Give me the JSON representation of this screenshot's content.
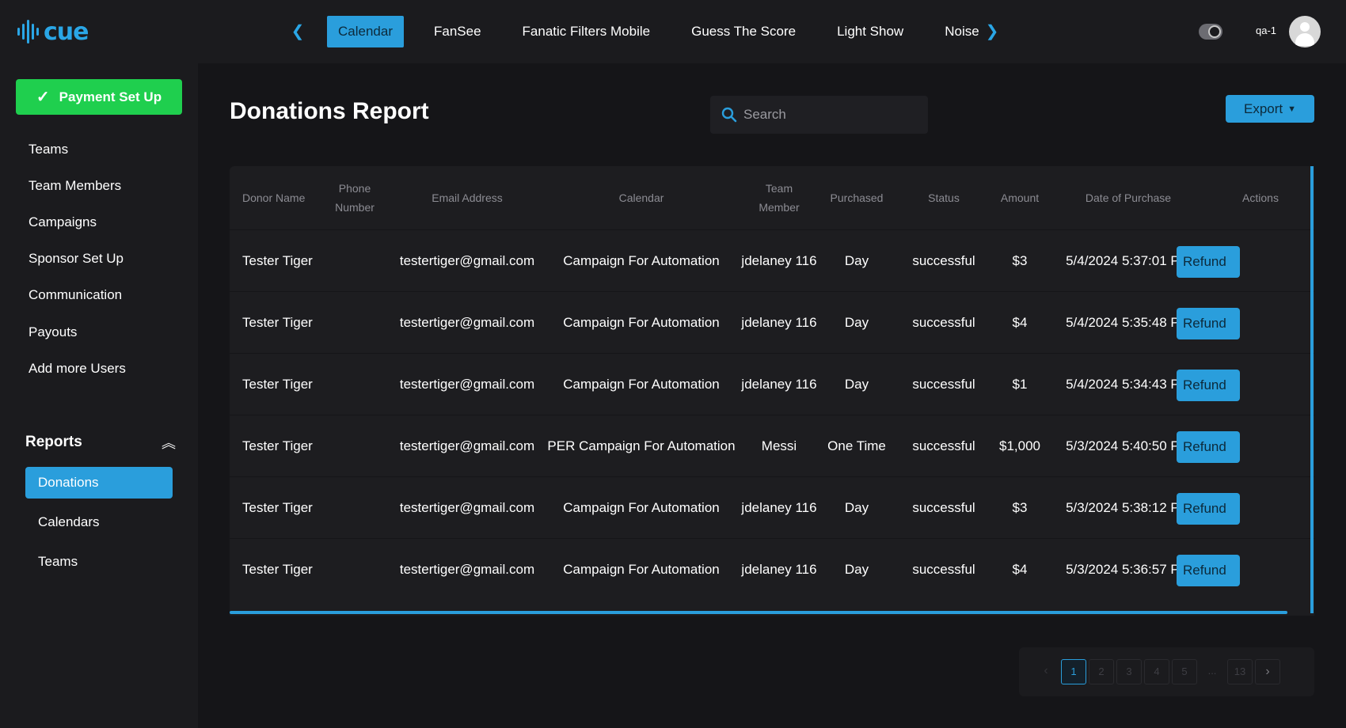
{
  "brand": {
    "name": "cue"
  },
  "tabs": [
    "Calendar",
    "FanSee",
    "Fanatic Filters Mobile",
    "Guess The Score",
    "Light Show",
    "Noise"
  ],
  "user": {
    "name": "qa-1"
  },
  "sidebar": {
    "payment_button": "Payment Set Up",
    "items": [
      "Teams",
      "Team Members",
      "Campaigns",
      "Sponsor Set Up",
      "Communication",
      "Payouts",
      "Add more Users"
    ],
    "reports": {
      "label": "Reports",
      "items": [
        "Donations",
        "Calendars",
        "Teams"
      ]
    }
  },
  "page": {
    "title": "Donations Report",
    "search_placeholder": "Search",
    "export_label": "Export"
  },
  "table": {
    "headers": [
      "Donor Name",
      "Phone Number",
      "Email Address",
      "Calendar",
      "Team Member",
      "Purchased",
      "Status",
      "Amount",
      "Date of Purchase",
      "Actions"
    ],
    "action_label": "Refund",
    "rows": [
      {
        "donor": "Tester Tiger",
        "phone": "",
        "email": "testertiger@gmail.com",
        "calendar": "Campaign For Automation",
        "member": "jdelaney 116",
        "purchased": "Day",
        "status": "successful",
        "amount": "$3",
        "date": "5/4/2024 5:37:01 PM"
      },
      {
        "donor": "Tester Tiger",
        "phone": "",
        "email": "testertiger@gmail.com",
        "calendar": "Campaign For Automation",
        "member": "jdelaney 116",
        "purchased": "Day",
        "status": "successful",
        "amount": "$4",
        "date": "5/4/2024 5:35:48 PM"
      },
      {
        "donor": "Tester Tiger",
        "phone": "",
        "email": "testertiger@gmail.com",
        "calendar": "Campaign For Automation",
        "member": "jdelaney 116",
        "purchased": "Day",
        "status": "successful",
        "amount": "$1",
        "date": "5/4/2024 5:34:43 PM"
      },
      {
        "donor": "Tester Tiger",
        "phone": "",
        "email": "testertiger@gmail.com",
        "calendar": "PER Campaign For Automation",
        "member": "Messi",
        "purchased": "One Time",
        "status": "successful",
        "amount": "$1,000",
        "date": "5/3/2024 5:40:50 PM"
      },
      {
        "donor": "Tester Tiger",
        "phone": "",
        "email": "testertiger@gmail.com",
        "calendar": "Campaign For Automation",
        "member": "jdelaney 116",
        "purchased": "Day",
        "status": "successful",
        "amount": "$3",
        "date": "5/3/2024 5:38:12 PM"
      },
      {
        "donor": "Tester Tiger",
        "phone": "",
        "email": "testertiger@gmail.com",
        "calendar": "Campaign For Automation",
        "member": "jdelaney 116",
        "purchased": "Day",
        "status": "successful",
        "amount": "$4",
        "date": "5/3/2024 5:36:57 PM"
      }
    ]
  },
  "pagination": {
    "pages": [
      "1",
      "2",
      "3",
      "4",
      "5",
      "...",
      "13"
    ],
    "current": "1"
  },
  "colors": {
    "accent": "#2a9edc",
    "success": "#1fcf4e",
    "background": "#151518",
    "panel": "#1b1b1e"
  }
}
